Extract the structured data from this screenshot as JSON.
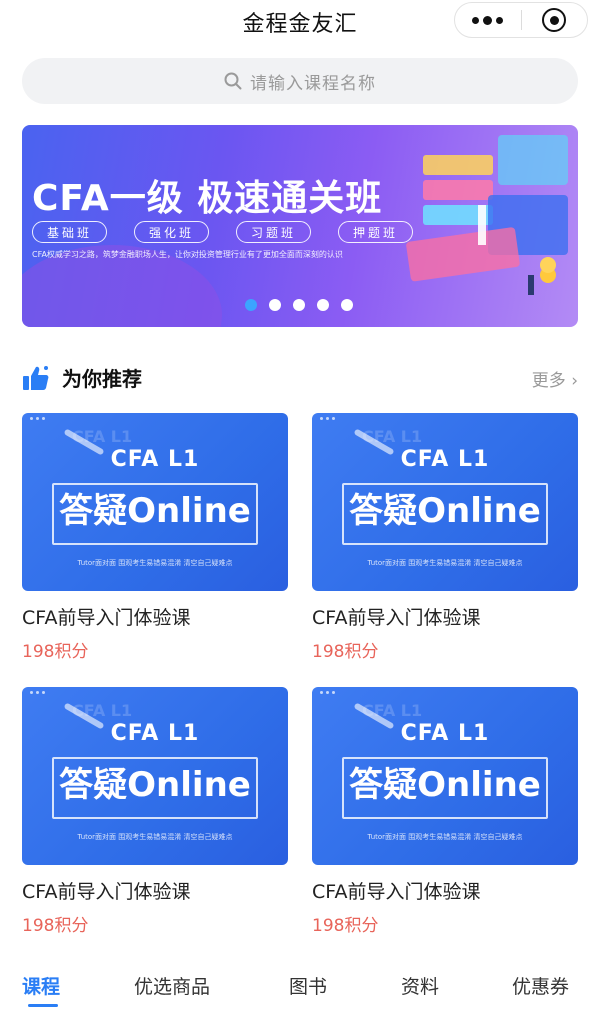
{
  "header": {
    "title": "金程金友汇",
    "more_icon": "more-dots-icon",
    "close_icon": "capsule-close-icon"
  },
  "search": {
    "placeholder": "请输入课程名称",
    "icon": "search-icon"
  },
  "banner": {
    "headline": "CFA一级 极速通关班",
    "pills": [
      "基础班",
      "强化班",
      "习题班",
      "押题班"
    ],
    "subtitle": "CFA权威学习之路，筑梦金融职场人生，让你对投资管理行业有了更加全面而深刻的认识",
    "carousel": {
      "count": 5,
      "active_index": 0
    },
    "colors": {
      "start": "#4a63f0",
      "end": "#b38bf5",
      "active_dot": "#3ba4ff"
    }
  },
  "section": {
    "title": "为你推荐",
    "more": "更多",
    "icon": "thumbs-up-icon"
  },
  "courses": [
    {
      "thumb_top": "CFA L1",
      "thumb_main": "答疑Online",
      "thumb_small": "Tutor面对面    围观考生易错易混淆    清空自己疑难点",
      "title": "CFA前导入门体验课",
      "price": "198积分"
    },
    {
      "thumb_top": "CFA L1",
      "thumb_main": "答疑Online",
      "thumb_small": "Tutor面对面    围观考生易错易混淆    清空自己疑难点",
      "title": "CFA前导入门体验课",
      "price": "198积分"
    },
    {
      "thumb_top": "CFA L1",
      "thumb_main": "答疑Online",
      "thumb_small": "Tutor面对面    围观考生易错易混淆    清空自己疑难点",
      "title": "CFA前导入门体验课",
      "price": "198积分"
    },
    {
      "thumb_top": "CFA L1",
      "thumb_main": "答疑Online",
      "thumb_small": "Tutor面对面    围观考生易错易混淆    清空自己疑难点",
      "title": "CFA前导入门体验课",
      "price": "198积分"
    }
  ],
  "tabs": [
    {
      "label": "课程",
      "active": true
    },
    {
      "label": "优选商品",
      "active": false
    },
    {
      "label": "图书",
      "active": false
    },
    {
      "label": "资料",
      "active": false
    },
    {
      "label": "优惠券",
      "active": false
    }
  ],
  "colors": {
    "accent": "#2a7ef5",
    "price": "#e8645a"
  }
}
